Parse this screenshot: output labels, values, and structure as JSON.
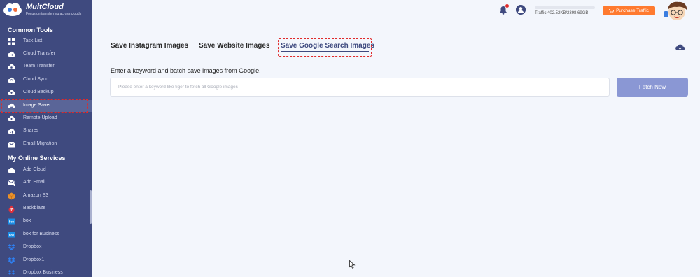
{
  "brand": {
    "name": "MultCloud",
    "tagline": "Focus on transferring across clouds"
  },
  "sidebar": {
    "section_tools": "Common Tools",
    "tools": [
      {
        "label": "Task List",
        "icon": "grid-icon"
      },
      {
        "label": "Cloud Transfer",
        "icon": "cloud-transfer-icon"
      },
      {
        "label": "Team Transfer",
        "icon": "team-transfer-icon"
      },
      {
        "label": "Cloud Sync",
        "icon": "cloud-sync-icon"
      },
      {
        "label": "Cloud Backup",
        "icon": "cloud-backup-icon"
      },
      {
        "label": "Image Saver",
        "icon": "image-saver-icon",
        "active": true
      },
      {
        "label": "Remote Upload",
        "icon": "remote-upload-icon"
      },
      {
        "label": "Shares",
        "icon": "shares-icon"
      },
      {
        "label": "Email Migration",
        "icon": "email-migration-icon"
      }
    ],
    "section_services": "My Online Services",
    "services": [
      {
        "label": "Add Cloud",
        "icon": "add-cloud-icon"
      },
      {
        "label": "Add Email",
        "icon": "add-email-icon"
      },
      {
        "label": "Amazon S3",
        "icon": "amazon-s3-icon"
      },
      {
        "label": "Backblaze",
        "icon": "backblaze-icon"
      },
      {
        "label": "box",
        "icon": "box-icon"
      },
      {
        "label": "box for Business",
        "icon": "box-business-icon"
      },
      {
        "label": "Dropbox",
        "icon": "dropbox-icon"
      },
      {
        "label": "Dropbox1",
        "icon": "dropbox-icon"
      },
      {
        "label": "Dropbox Business",
        "icon": "dropbox-business-icon"
      }
    ]
  },
  "topbar": {
    "traffic_text": "Traffic:402.52KB/2398.69GB",
    "traffic_used_fraction": 0.0,
    "purchase_label": "Purchase Traffic"
  },
  "tabs": [
    {
      "label": "Save Instagram Images"
    },
    {
      "label": "Save Website Images"
    },
    {
      "label": "Save Google Search Images",
      "active": true
    }
  ],
  "main": {
    "instruction": "Enter a keyword and batch save images from Google.",
    "input_placeholder": "Please enter a keyword like tiger to fetch all Google images",
    "input_value": "",
    "fetch_label": "Fetch Now"
  },
  "colors": {
    "sidebar_bg": "#3f4a7f",
    "accent": "#3f4a7f",
    "fetch_button": "#8a97d4",
    "purchase_button": "#ff7a2f",
    "highlight_outline": "#e02a2a"
  }
}
